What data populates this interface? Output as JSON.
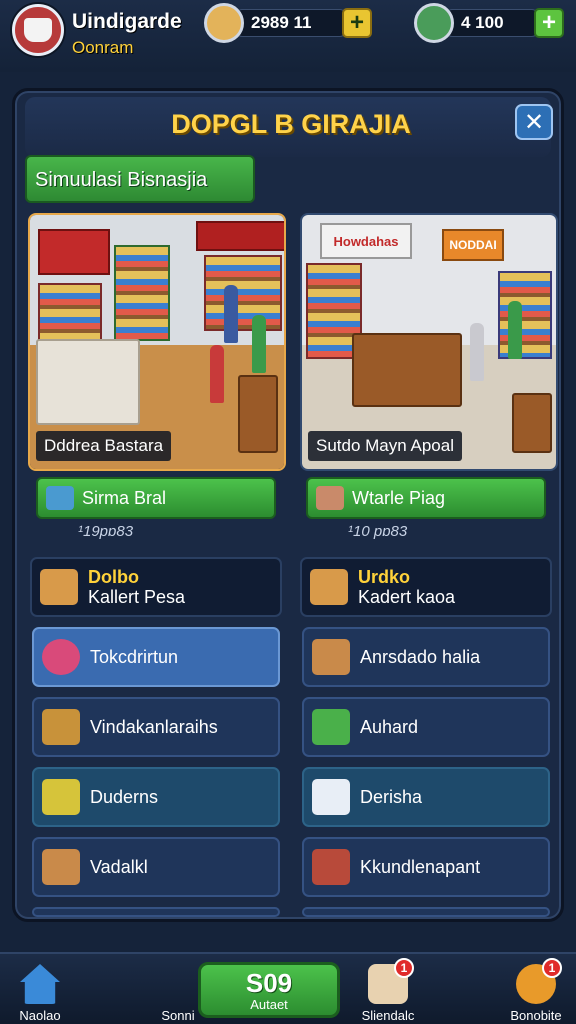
{
  "player": {
    "name": "Uindigarde",
    "subtitle": "Oonram"
  },
  "resources": [
    {
      "icon": "coin-scroll-icon",
      "value": "2989  11"
    },
    {
      "icon": "character-gem-icon",
      "value": "4  100"
    }
  ],
  "panel": {
    "title": "DOPGL B GIRAJIA",
    "banner": "Simuulasi Bisnasjia"
  },
  "stores": [
    {
      "name": "Dddrea Bastara",
      "button": "Sirma Bral",
      "price": "¹19pɒ83"
    },
    {
      "name": "Sutdo Mayn Apoal",
      "sign": "Howdahas",
      "sign2": "NODDAI",
      "button": "Wtarle Piag",
      "price": "¹10 pɒ83"
    }
  ],
  "categories": {
    "left": [
      {
        "title": "Dolbo",
        "subtitle": "Kallert Pesa",
        "icon": "toolbox-icon"
      },
      {
        "label": "Tokcdrirtun",
        "icon": "toy-icon"
      },
      {
        "label": "Vindakanlaraihs",
        "icon": "tools-icon"
      },
      {
        "label": "Duderns",
        "icon": "cart-icon"
      },
      {
        "label": "Vadalkl",
        "icon": "crate-icon"
      }
    ],
    "right": [
      {
        "title": "Urdko",
        "subtitle": "Kadert kaoa",
        "icon": "box-icon"
      },
      {
        "label": "Anrsdado halia",
        "icon": "cashier-icon"
      },
      {
        "label": "Auhard",
        "icon": "basket-icon"
      },
      {
        "label": "Derisha",
        "icon": "package-icon"
      },
      {
        "label": "Kkundlenapant",
        "icon": "cash-register-icon"
      }
    ]
  },
  "bottom_nav": {
    "home": "Naolao",
    "second": "Sonni",
    "center_value": "S09",
    "center_label": "Autaet",
    "fourth": "Sliendalc",
    "fifth": "Bonobite",
    "fourth_badge": "1",
    "fifth_badge": "1"
  },
  "colors": {
    "accent_green": "#3fae4a",
    "title_yellow": "#ffd34a",
    "panel_blue": "#1a2944"
  }
}
